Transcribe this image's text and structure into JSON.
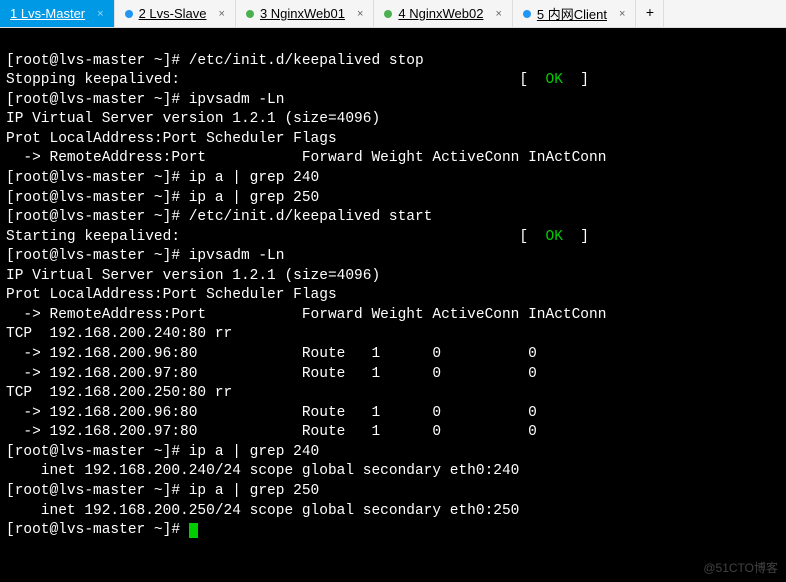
{
  "tabs": [
    {
      "label": "1 Lvs-Master",
      "dot": "blue",
      "active": true
    },
    {
      "label": "2 Lvs-Slave",
      "dot": "blue",
      "active": false
    },
    {
      "label": "3 NginxWeb01",
      "dot": "green",
      "active": false
    },
    {
      "label": "4 NginxWeb02",
      "dot": "green",
      "active": false
    },
    {
      "label": "5 内网Client",
      "dot": "blue",
      "active": false
    }
  ],
  "add_tab": "+",
  "close_x": "×",
  "watermark": "@51CTO博客",
  "term": {
    "l0_prompt": "[root@lvs-master ~]# ",
    "l0_cmd": "/etc/init.d/keepalived stop",
    "l1_pre": "Stopping keepalived:                                       [  ",
    "l1_ok": "OK",
    "l1_post": "  ]",
    "l2_prompt": "[root@lvs-master ~]# ",
    "l2_cmd": "ipvsadm -Ln",
    "l3": "IP Virtual Server version 1.2.1 (size=4096)",
    "l4": "Prot LocalAddress:Port Scheduler Flags",
    "l5": "  -> RemoteAddress:Port           Forward Weight ActiveConn InActConn",
    "l6_prompt": "[root@lvs-master ~]# ",
    "l6_cmd": "ip a | grep 240",
    "l7_prompt": "[root@lvs-master ~]# ",
    "l7_cmd": "ip a | grep 250",
    "l8_prompt": "[root@lvs-master ~]# ",
    "l8_cmd": "/etc/init.d/keepalived start",
    "l9_pre": "Starting keepalived:                                       [  ",
    "l9_ok": "OK",
    "l9_post": "  ]",
    "l10_prompt": "[root@lvs-master ~]# ",
    "l10_cmd": "ipvsadm -Ln",
    "l11": "IP Virtual Server version 1.2.1 (size=4096)",
    "l12": "Prot LocalAddress:Port Scheduler Flags",
    "l13": "  -> RemoteAddress:Port           Forward Weight ActiveConn InActConn",
    "l14": "TCP  192.168.200.240:80 rr",
    "l15": "  -> 192.168.200.96:80            Route   1      0          0         ",
    "l16": "  -> 192.168.200.97:80            Route   1      0          0         ",
    "l17": "TCP  192.168.200.250:80 rr",
    "l18": "  -> 192.168.200.96:80            Route   1      0          0         ",
    "l19": "  -> 192.168.200.97:80            Route   1      0          0         ",
    "l20_prompt": "[root@lvs-master ~]# ",
    "l20_cmd": "ip a | grep 240",
    "l21": "    inet 192.168.200.240/24 scope global secondary eth0:240",
    "l22_prompt": "[root@lvs-master ~]# ",
    "l22_cmd": "ip a | grep 250",
    "l23": "    inet 192.168.200.250/24 scope global secondary eth0:250",
    "l24_prompt": "[root@lvs-master ~]# "
  }
}
